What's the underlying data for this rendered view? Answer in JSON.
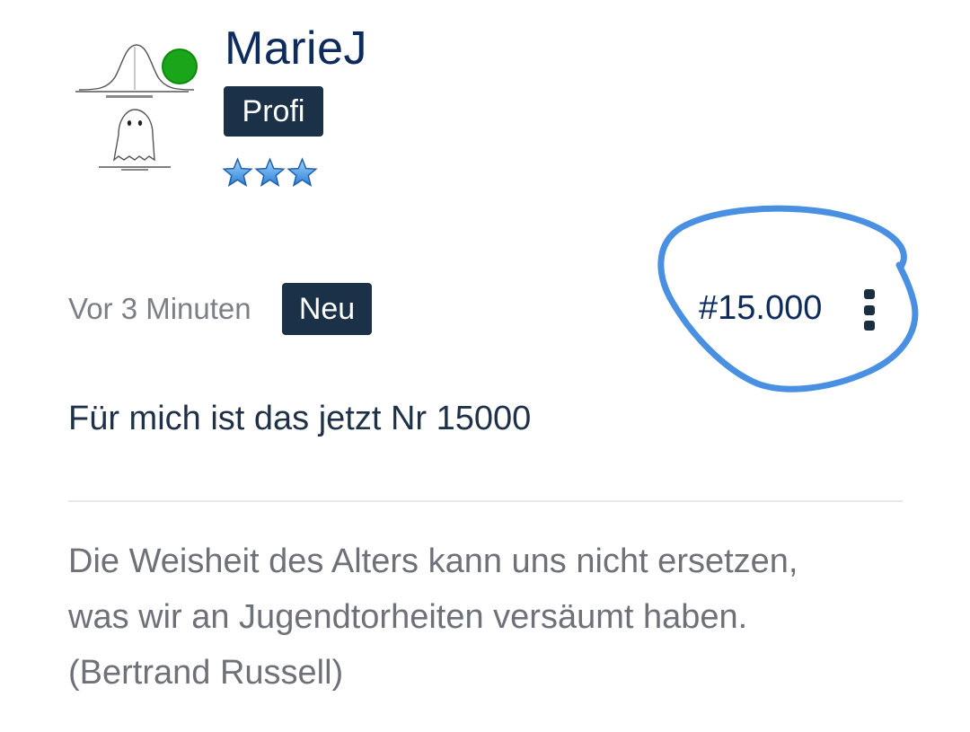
{
  "post": {
    "author": {
      "username": "MarieJ",
      "rank": "Profi",
      "stars": 3,
      "online_status_color": "#1aa51a",
      "avatar_icon": "normal-distribution-ghost-avatar"
    },
    "timestamp": "Vor 3 Minuten",
    "new_badge": "Neu",
    "post_number": "#15.000",
    "menu_icon": "kebab-menu-icon",
    "body": "Für mich ist das jetzt Nr 15000",
    "signature": {
      "line1": "Die Weisheit des Alters kann uns nicht ersetzen,",
      "line2": "was wir an Jugendtorheiten versäumt haben.",
      "line3": "(Bertrand Russell)"
    }
  },
  "annotation": {
    "type": "hand-drawn-circle",
    "color": "#4a90e2"
  },
  "colors": {
    "badge_bg": "#1b3148",
    "username": "#0d2b5c",
    "muted_text": "#7b7f86"
  }
}
